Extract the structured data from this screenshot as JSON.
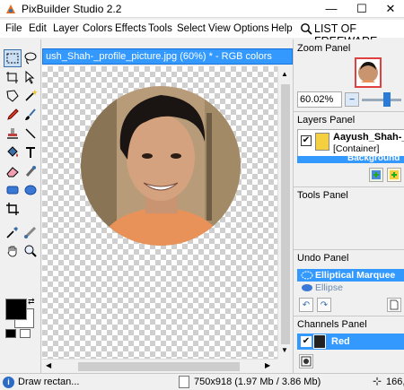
{
  "window": {
    "title": "PixBuilder Studio 2.2",
    "minimize": "—",
    "maximize": "☐",
    "close": "✕"
  },
  "menu": [
    "File",
    "Edit",
    "Layer",
    "Colors",
    "Effects",
    "Tools",
    "Select",
    "View",
    "Options",
    "Help"
  ],
  "menu_extra": "LIST OF FREEWARE",
  "document": {
    "tab_title": "ush_Shah-_profile_picture.jpg (60%) * - RGB colors"
  },
  "zoom_panel": {
    "title": "Zoom Panel",
    "zoom_value": "60.02%"
  },
  "layers_panel": {
    "title": "Layers Panel",
    "layer_name": "Aayush_Shah-_p",
    "layer_type": "[Container]",
    "sublayer_name": "Background"
  },
  "tools_panel": {
    "title": "Tools Panel"
  },
  "undo_panel": {
    "title": "Undo Panel",
    "items": [
      "Elliptical Marquee",
      "Ellipse"
    ]
  },
  "channels_panel": {
    "title": "Channels Panel",
    "channel_name": "Red"
  },
  "status": {
    "hint": "Draw rectan...",
    "dimensions": "750x918 (1.97 Mb / 3.86 Mb)",
    "coords": "166,"
  },
  "colors": {
    "accent": "#3399ff",
    "foreground": "#000000",
    "background": "#ffffff"
  }
}
